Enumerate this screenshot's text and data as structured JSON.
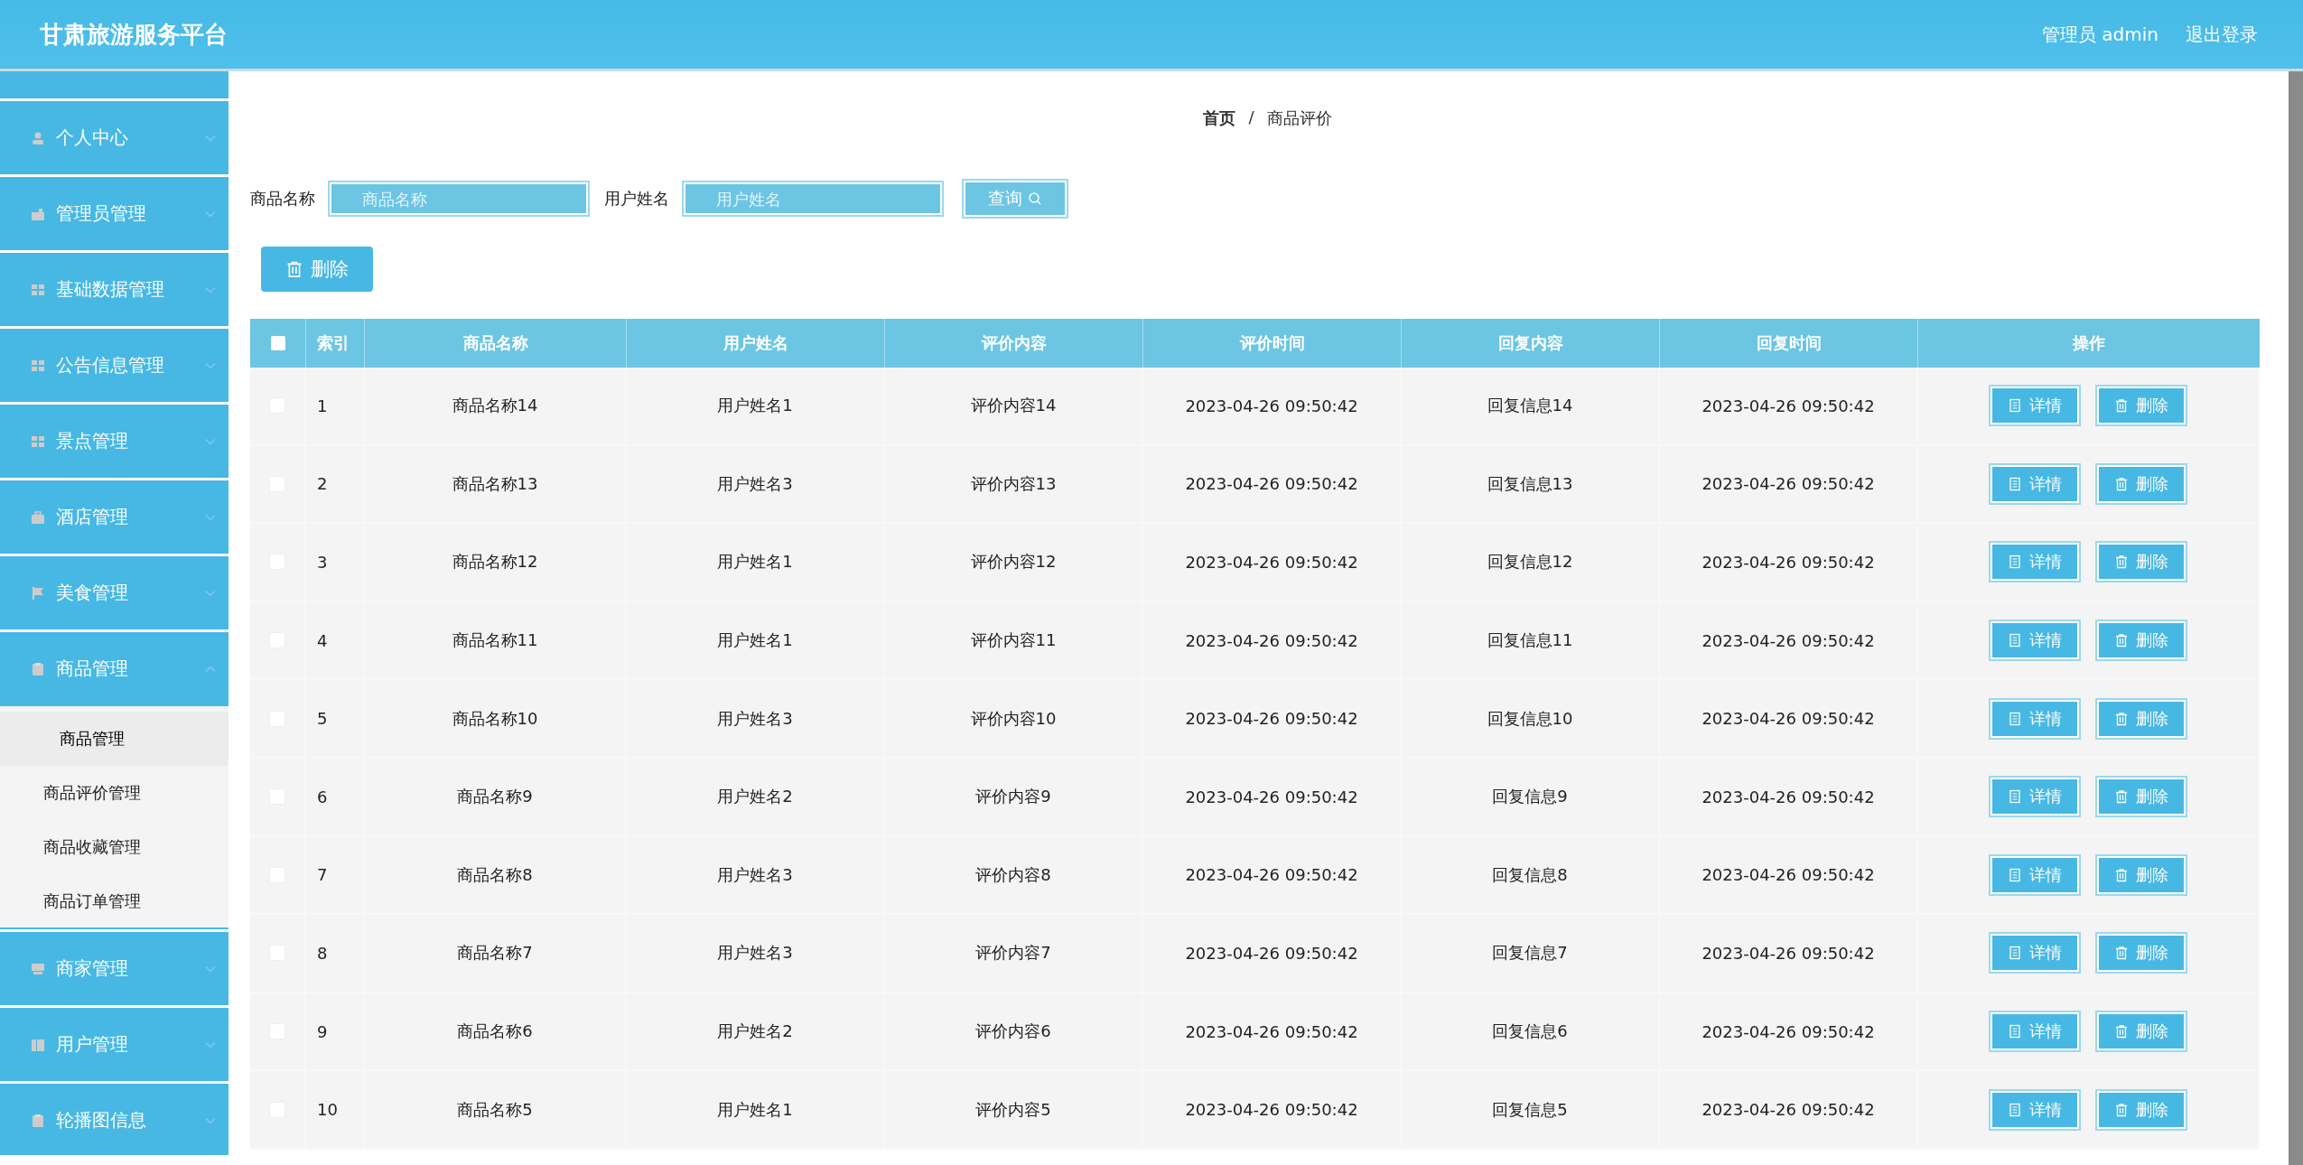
{
  "header": {
    "title": "甘肃旅游服务平台",
    "user": "管理员 admin",
    "logout": "退出登录"
  },
  "sidebar": {
    "items": [
      {
        "label": "个人中心",
        "expanded": false
      },
      {
        "label": "管理员管理",
        "expanded": false
      },
      {
        "label": "基础数据管理",
        "expanded": false
      },
      {
        "label": "公告信息管理",
        "expanded": false
      },
      {
        "label": "景点管理",
        "expanded": false
      },
      {
        "label": "酒店管理",
        "expanded": false
      },
      {
        "label": "美食管理",
        "expanded": false
      },
      {
        "label": "商品管理",
        "expanded": true,
        "children": [
          {
            "label": "商品管理",
            "selected": true
          },
          {
            "label": "商品评价管理",
            "selected": false
          },
          {
            "label": "商品收藏管理",
            "selected": false
          },
          {
            "label": "商品订单管理",
            "selected": false
          }
        ]
      },
      {
        "label": "商家管理",
        "expanded": false
      },
      {
        "label": "用户管理",
        "expanded": false
      },
      {
        "label": "轮播图信息",
        "expanded": false
      }
    ]
  },
  "breadcrumb": [
    "首页",
    "/",
    "商品评价"
  ],
  "search": {
    "fields": [
      {
        "label": "商品名称",
        "placeholder": "商品名称"
      },
      {
        "label": "用户姓名",
        "placeholder": "用户姓名"
      }
    ],
    "button": "查询"
  },
  "bulk_delete": "删除",
  "table": {
    "header_checked": false,
    "columns": [
      "索引",
      "商品名称",
      "用户姓名",
      "评价内容",
      "评价时间",
      "回复内容",
      "回复时间",
      "操作"
    ],
    "rows": [
      {
        "checked": false,
        "cells": [
          "1",
          "商品名称14",
          "用户姓名1",
          "评价内容14",
          "2023-04-26 09:50:42",
          "回复信息14",
          "2023-04-26 09:50:42"
        ],
        "actions": [
          "详情",
          "删除"
        ]
      },
      {
        "checked": false,
        "cells": [
          "2",
          "商品名称13",
          "用户姓名3",
          "评价内容13",
          "2023-04-26 09:50:42",
          "回复信息13",
          "2023-04-26 09:50:42"
        ],
        "actions": [
          "详情",
          "删除"
        ]
      },
      {
        "checked": false,
        "cells": [
          "3",
          "商品名称12",
          "用户姓名1",
          "评价内容12",
          "2023-04-26 09:50:42",
          "回复信息12",
          "2023-04-26 09:50:42"
        ],
        "actions": [
          "详情",
          "删除"
        ]
      },
      {
        "checked": false,
        "cells": [
          "4",
          "商品名称11",
          "用户姓名1",
          "评价内容11",
          "2023-04-26 09:50:42",
          "回复信息11",
          "2023-04-26 09:50:42"
        ],
        "actions": [
          "详情",
          "删除"
        ]
      },
      {
        "checked": false,
        "cells": [
          "5",
          "商品名称10",
          "用户姓名3",
          "评价内容10",
          "2023-04-26 09:50:42",
          "回复信息10",
          "2023-04-26 09:50:42"
        ],
        "actions": [
          "详情",
          "删除"
        ]
      },
      {
        "checked": false,
        "cells": [
          "6",
          "商品名称9",
          "用户姓名2",
          "评价内容9",
          "2023-04-26 09:50:42",
          "回复信息9",
          "2023-04-26 09:50:42"
        ],
        "actions": [
          "详情",
          "删除"
        ]
      },
      {
        "checked": false,
        "cells": [
          "7",
          "商品名称8",
          "用户姓名3",
          "评价内容8",
          "2023-04-26 09:50:42",
          "回复信息8",
          "2023-04-26 09:50:42"
        ],
        "actions": [
          "详情",
          "删除"
        ]
      },
      {
        "checked": false,
        "cells": [
          "8",
          "商品名称7",
          "用户姓名3",
          "评价内容7",
          "2023-04-26 09:50:42",
          "回复信息7",
          "2023-04-26 09:50:42"
        ],
        "actions": [
          "详情",
          "删除"
        ]
      },
      {
        "checked": false,
        "cells": [
          "9",
          "商品名称6",
          "用户姓名2",
          "评价内容6",
          "2023-04-26 09:50:42",
          "回复信息6",
          "2023-04-26 09:50:42"
        ],
        "actions": [
          "详情",
          "删除"
        ]
      },
      {
        "checked": false,
        "cells": [
          "10",
          "商品名称5",
          "用户姓名1",
          "评价内容5",
          "2023-04-26 09:50:42",
          "回复信息5",
          "2023-04-26 09:50:42"
        ],
        "actions": [
          "详情",
          "删除"
        ]
      }
    ]
  }
}
